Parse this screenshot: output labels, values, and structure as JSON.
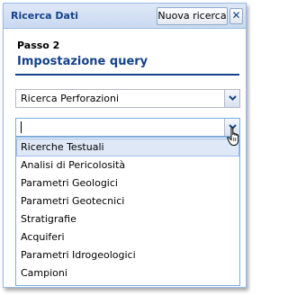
{
  "panel": {
    "title": "Ricerca Dati",
    "new_search_label": "Nuova ricerca",
    "close_glyph": "✕"
  },
  "step": {
    "label": "Passo 2",
    "title": "Impostazione query"
  },
  "combo_search_type": {
    "value": "Ricerca Perforazioni",
    "trigger_icon": "chevron-down-icon"
  },
  "combo_query": {
    "value": "",
    "trigger_icon": "chevron-down-icon"
  },
  "dropdown": {
    "selected_index": 0,
    "items": [
      "Ricerche Testuali",
      "Analisi di Pericolosità",
      "Parametri Geologici",
      "Parametri Geotecnici",
      "Stratigrafie",
      "Acquiferi",
      "Parametri Idrogeologici",
      "Campioni"
    ]
  },
  "colors": {
    "accent": "#15428b",
    "border": "#99bbe8",
    "selected_bg": "#dfe8f6"
  }
}
